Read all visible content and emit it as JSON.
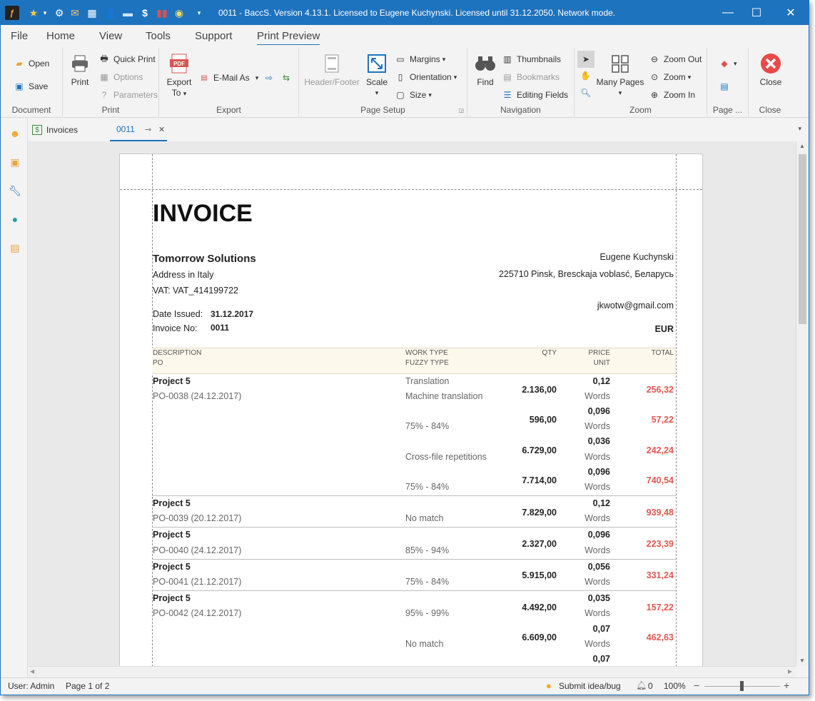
{
  "window": {
    "title": "0011 - BaccS. Version 4.13.1. Licensed to Eugene Kuchynski. Licensed until 31.12.2050. Network mode.",
    "accent": "#1e73be"
  },
  "menu": [
    "File",
    "Home",
    "View",
    "Tools",
    "Support",
    "Print Preview"
  ],
  "ribbon": {
    "document": {
      "label": "Document",
      "open": "Open",
      "save": "Save"
    },
    "print": {
      "label": "Print",
      "print": "Print",
      "quick_print": "Quick Print",
      "options": "Options",
      "parameters": "Parameters"
    },
    "export": {
      "label": "Export",
      "export_to_1": "Export",
      "export_to_2": "To",
      "email_as": "E-Mail As"
    },
    "page_setup": {
      "label": "Page Setup",
      "header_footer": "Header/Footer",
      "scale": "Scale",
      "margins": "Margins",
      "orientation": "Orientation",
      "size": "Size"
    },
    "navigation": {
      "label": "Navigation",
      "find": "Find",
      "thumbnails": "Thumbnails",
      "bookmarks": "Bookmarks",
      "editing_fields": "Editing Fields"
    },
    "zoom": {
      "label": "Zoom",
      "many_pages": "Many Pages",
      "zoom_out": "Zoom Out",
      "zoom": "Zoom",
      "zoom_in": "Zoom In"
    },
    "page_bg": {
      "label": "Page ..."
    },
    "close": {
      "label": "Close",
      "close": "Close"
    }
  },
  "tabs": [
    {
      "label": "Invoices"
    },
    {
      "label": "0011"
    }
  ],
  "invoice": {
    "heading": "INVOICE",
    "company": "Tomorrow Solutions",
    "address": "Address in Italy",
    "vat": "VAT: VAT_414199722",
    "date_label": "Date Issued:",
    "date_value": "31.12.2017",
    "invoice_label": "Invoice No:",
    "invoice_value": "0011",
    "client_name": "Eugene Kuchynski",
    "client_address": "225710 Pinsk, Bresckaja voblasć, Беларусь",
    "client_email": "jkwotw@gmail.com",
    "currency": "EUR",
    "headers": {
      "description": "DESCRIPTION",
      "po": "PO",
      "work_type": "WORK TYPE",
      "fuzzy_type": "FUZZY TYPE",
      "qty": "QTY",
      "price": "PRICE",
      "unit": "UNIT",
      "total": "TOTAL"
    },
    "rows": [
      {
        "project": "Project 5",
        "po": "PO-0038 (24.12.2017)",
        "work": "Translation",
        "fuzzy": "Machine translation",
        "qty": "2.136,00",
        "price": "0,12",
        "unit": "Words",
        "total": "256,32"
      },
      {
        "fuzzy": "75% - 84%",
        "qty": "596,00",
        "price": "0,096",
        "unit": "Words",
        "total": "57,22"
      },
      {
        "fuzzy": "Cross-file repetitions",
        "qty": "6.729,00",
        "price": "0,036",
        "unit": "Words",
        "total": "242,24"
      },
      {
        "fuzzy": "75% - 84%",
        "qty": "7.714,00",
        "price": "0,096",
        "unit": "Words",
        "total": "740,54"
      },
      {
        "project": "Project 5",
        "po": "PO-0039 (20.12.2017)",
        "fuzzy": "No match",
        "qty": "7.829,00",
        "price": "0,12",
        "unit": "Words",
        "total": "939,48"
      },
      {
        "project": "Project 5",
        "po": "PO-0040 (24.12.2017)",
        "fuzzy": "85% - 94%",
        "qty": "2.327,00",
        "price": "0,096",
        "unit": "Words",
        "total": "223,39"
      },
      {
        "project": "Project 5",
        "po": "PO-0041 (21.12.2017)",
        "fuzzy": "75% - 84%",
        "qty": "5.915,00",
        "price": "0,056",
        "unit": "Words",
        "total": "331,24"
      },
      {
        "project": "Project 5",
        "po": "PO-0042 (24.12.2017)",
        "fuzzy": "95% - 99%",
        "qty": "4.492,00",
        "price": "0,035",
        "unit": "Words",
        "total": "157,22"
      },
      {
        "fuzzy": "No match",
        "qty": "6.609,00",
        "price": "0,07",
        "unit": "Words",
        "total": "462,63"
      },
      {
        "price": "0,07"
      }
    ]
  },
  "status": {
    "user": "User: Admin",
    "page": "Page 1 of 2",
    "submit": "Submit idea/bug",
    "count": "0",
    "zoom": "100%",
    "zoom_level": 1.0
  }
}
